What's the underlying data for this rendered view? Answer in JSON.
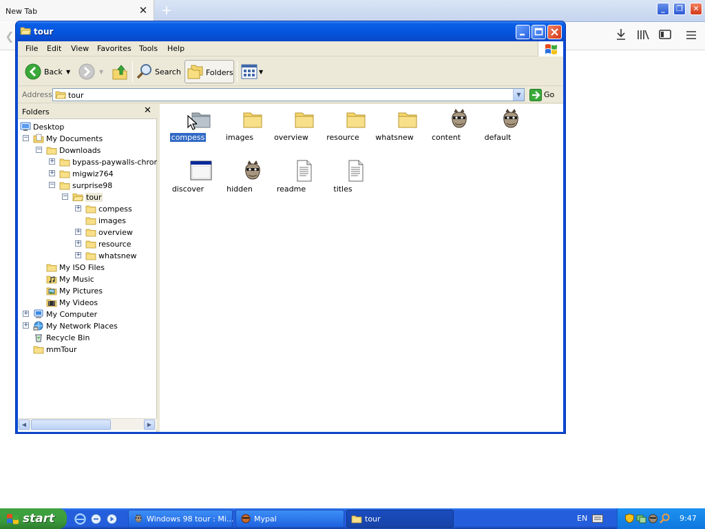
{
  "browser": {
    "tab_title": "New Tab",
    "tab_close": "✕",
    "new_tab": "+"
  },
  "window": {
    "title": "tour",
    "btn_min": "_",
    "btn_max": "□",
    "btn_close": "✕"
  },
  "menu": [
    "File",
    "Edit",
    "View",
    "Favorites",
    "Tools",
    "Help"
  ],
  "toolbar": {
    "back_label": "Back",
    "search_label": "Search",
    "folders_label": "Folders"
  },
  "address": {
    "label": "Address",
    "value": "tour",
    "go_label": "Go"
  },
  "folders_pane": {
    "title": "Folders",
    "close": "✕",
    "tree": [
      {
        "label": "Desktop",
        "icon": "desktop-icon",
        "expander": ""
      },
      {
        "label": "My Documents",
        "icon": "my-documents-icon",
        "expander": "−"
      },
      {
        "label": "Downloads",
        "icon": "folder-icon",
        "expander": "−"
      },
      {
        "label": "bypass-paywalls-chrome-",
        "icon": "folder-icon",
        "expander": "+"
      },
      {
        "label": "migwiz764",
        "icon": "folder-icon",
        "expander": "+"
      },
      {
        "label": "surprise98",
        "icon": "folder-icon",
        "expander": "−"
      },
      {
        "label": "tour",
        "icon": "folder-open-icon",
        "expander": "−"
      },
      {
        "label": "compess",
        "icon": "folder-icon",
        "expander": "+"
      },
      {
        "label": "images",
        "icon": "folder-icon",
        "expander": ""
      },
      {
        "label": "overview",
        "icon": "folder-icon",
        "expander": "+"
      },
      {
        "label": "resource",
        "icon": "folder-icon",
        "expander": "+"
      },
      {
        "label": "whatsnew",
        "icon": "folder-icon",
        "expander": "+"
      },
      {
        "label": "My ISO Files",
        "icon": "folder-icon",
        "expander": ""
      },
      {
        "label": "My Music",
        "icon": "music-folder-icon",
        "expander": ""
      },
      {
        "label": "My Pictures",
        "icon": "pictures-folder-icon",
        "expander": ""
      },
      {
        "label": "My Videos",
        "icon": "videos-folder-icon",
        "expander": ""
      },
      {
        "label": "My Computer",
        "icon": "computer-icon",
        "expander": "+"
      },
      {
        "label": "My Network Places",
        "icon": "network-icon",
        "expander": "+"
      },
      {
        "label": "Recycle Bin",
        "icon": "recycle-bin-icon",
        "expander": ""
      },
      {
        "label": "mmTour",
        "icon": "folder-icon",
        "expander": ""
      }
    ]
  },
  "files": [
    {
      "name": "compess",
      "icon": "folder-icon"
    },
    {
      "name": "images",
      "icon": "folder-icon"
    },
    {
      "name": "overview",
      "icon": "folder-icon"
    },
    {
      "name": "resource",
      "icon": "folder-icon"
    },
    {
      "name": "whatsnew",
      "icon": "folder-icon"
    },
    {
      "name": "content",
      "icon": "raccoon-app-icon"
    },
    {
      "name": "default",
      "icon": "raccoon-app-icon"
    },
    {
      "name": "discover",
      "icon": "window-app-icon"
    },
    {
      "name": "hidden",
      "icon": "raccoon-app-icon"
    },
    {
      "name": "readme",
      "icon": "text-document-icon"
    },
    {
      "name": "titles",
      "icon": "text-document-icon"
    }
  ],
  "taskbar": {
    "start_label": "start",
    "tasks": [
      {
        "label": "Windows 98 tour : Mi...",
        "icon": "raccoon-app-icon"
      },
      {
        "label": "Mypal",
        "icon": "mypal-icon"
      },
      {
        "label": "tour",
        "icon": "folder-icon"
      }
    ],
    "language": "EN",
    "clock": "9:47"
  },
  "colors": {
    "selection": "#316ac5",
    "titlebar": "#0453dc",
    "taskbar": "#245edc",
    "start": "#3b9a3b",
    "folder": "#f1d46b"
  }
}
